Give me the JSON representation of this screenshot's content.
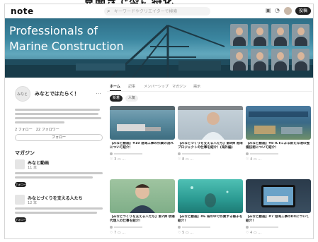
{
  "caption": {
    "text": "見開きで型に特化"
  },
  "topbar": {
    "logo": "note",
    "search_placeholder": "キーワードやクリエイターで検索",
    "icons": [
      "search-icon",
      "gift-icon",
      "bell-icon",
      "avatar",
      "post-button"
    ],
    "post_label": "投稿"
  },
  "banner": {
    "title_line1": "Professionals of",
    "title_line2": "Marine Construction"
  },
  "profile": {
    "avatar_text": "みなと",
    "name": "みなとではたらく！",
    "more": "…",
    "followers_text": "2 フォロー　22 フォロワー",
    "follow_label": "フォロー"
  },
  "magazines": {
    "title": "マガジン",
    "items": [
      {
        "name": "みなと動画",
        "count": "11 本",
        "follow": "フォロー"
      },
      {
        "name": "みなとづくりを支える人たち",
        "count": "12 本",
        "follow": "フォロー"
      }
    ]
  },
  "tabs": [
    {
      "label": "ホーム",
      "active": true
    },
    {
      "label": "記事",
      "active": false
    },
    {
      "label": "メンバーシップ",
      "active": false
    },
    {
      "label": "マガジン",
      "active": false
    },
    {
      "label": "掲示",
      "active": false
    }
  ],
  "filters": [
    {
      "label": "新着",
      "active": true
    },
    {
      "label": "人気",
      "active": false
    }
  ],
  "cards": [
    {
      "title": "【みなと動画】#10 港湾工事の作業の流れについて紹介！",
      "likes": "3",
      "thumb": "harbor-aerial"
    },
    {
      "title": "【みなとづくりを支える人たち】第8弾 港湾プロジェクトの仕事を紹介！(海外編)",
      "likes": "8",
      "thumb": "person-office"
    },
    {
      "title": "【みなと動画】#8 ICTによる新たな港の整備技術について紹介！",
      "likes": "4",
      "thumb": "ict-construction"
    },
    {
      "title": "【みなとづくりを支える人たち】第7弾 現場代理人の仕事を紹介！",
      "likes": "7",
      "thumb": "person-portrait"
    },
    {
      "title": "【みなと動画】#6 海の中で作業する様子を紹介！",
      "likes": "5",
      "thumb": "underwater"
    },
    {
      "title": "【みなと動画】#7 港湾工事のDXについて紹介！",
      "likes": "4",
      "thumb": "tablet-port"
    }
  ],
  "colors": {
    "banner_teal": "#3b86a0",
    "dark": "#222222"
  }
}
